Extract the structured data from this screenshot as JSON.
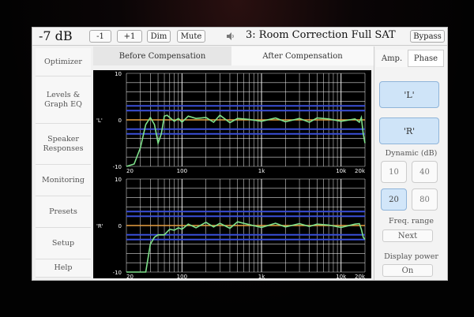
{
  "header": {
    "volume": "-7 dB",
    "btn_minus": "-1",
    "btn_plus": "+1",
    "btn_dim": "Dim",
    "btn_mute": "Mute",
    "preset_title": "3: Room Correction Full SAT",
    "btn_bypass": "Bypass"
  },
  "sidebar": {
    "items": [
      {
        "label": "Optimizer"
      },
      {
        "label": "Levels &\nGraph EQ"
      },
      {
        "label": "Speaker\nResponses"
      },
      {
        "label": "Monitoring"
      },
      {
        "label": "Presets"
      },
      {
        "label": "Setup"
      },
      {
        "label": "Help"
      }
    ]
  },
  "tabs": {
    "before": "Before Compensation",
    "after": "After Compensation"
  },
  "right_panel": {
    "tab_amp": "Amp.",
    "tab_phase": "Phase",
    "btn_left": "'L'",
    "btn_right": "'R'",
    "dynamic_label": "Dynamic (dB)",
    "dynamic_options": [
      "10",
      "40",
      "20",
      "80"
    ],
    "dynamic_selected": "20",
    "freq_label": "Freq. range",
    "freq_button": "Next",
    "power_label": "Display power",
    "power_button": "On"
  },
  "chart_data": [
    {
      "type": "line",
      "channel_label": "'L'",
      "xscale": "log",
      "xlim": [
        20,
        20000
      ],
      "ylim": [
        -10,
        10
      ],
      "x_ticks": [
        "20",
        "100",
        "1k",
        "10k",
        "20k"
      ],
      "y_ticks": [
        "10",
        "0",
        "-10"
      ],
      "grid": true,
      "reference_lines": {
        "orange": [
          0
        ],
        "blue": [
          3,
          2,
          -2,
          -3
        ]
      },
      "colors": {
        "response": "#7ee08a",
        "zero": "#e8a040",
        "band": "#3a4fd8",
        "grid": "#ffffff"
      },
      "x": [
        20,
        25,
        30,
        35,
        40,
        45,
        50,
        55,
        60,
        65,
        70,
        80,
        90,
        100,
        120,
        150,
        200,
        250,
        300,
        400,
        500,
        700,
        1000,
        1500,
        2000,
        3000,
        4000,
        5000,
        7000,
        10000,
        15000,
        17000,
        18000,
        19000,
        20000
      ],
      "y": [
        -10,
        -9.5,
        -6,
        -1,
        0.5,
        -1,
        -5,
        -3,
        0.8,
        1,
        0.5,
        -0.3,
        0.3,
        -0.5,
        0.8,
        0.3,
        0.5,
        -0.5,
        1,
        -0.6,
        0.3,
        0.1,
        -0.3,
        0.4,
        -0.4,
        0.3,
        -0.5,
        0.4,
        0.2,
        -0.3,
        0.2,
        -0.5,
        0.5,
        -3,
        -5
      ]
    },
    {
      "type": "line",
      "channel_label": "'R'",
      "xscale": "log",
      "xlim": [
        20,
        20000
      ],
      "ylim": [
        -10,
        10
      ],
      "x_ticks": [
        "20",
        "100",
        "1k",
        "10k",
        "20k"
      ],
      "y_ticks": [
        "10",
        "0",
        "-10"
      ],
      "grid": true,
      "reference_lines": {
        "orange": [
          0
        ],
        "blue": [
          3,
          2,
          -2,
          -3
        ]
      },
      "colors": {
        "response": "#7ee08a",
        "zero": "#e8a040",
        "band": "#3a4fd8",
        "grid": "#ffffff"
      },
      "x": [
        20,
        25,
        30,
        35,
        40,
        45,
        50,
        60,
        70,
        80,
        90,
        100,
        120,
        150,
        200,
        250,
        300,
        400,
        500,
        700,
        1000,
        1500,
        2000,
        3000,
        4000,
        5000,
        7000,
        10000,
        15000,
        17000,
        18000,
        19000,
        20000
      ],
      "y": [
        -10,
        -10,
        -10,
        -10,
        -4,
        -2.5,
        -2,
        -2,
        -0.8,
        -1,
        -0.5,
        -0.8,
        0.3,
        -0.5,
        0.7,
        -0.3,
        0.5,
        -0.6,
        0.8,
        0.2,
        -0.4,
        0.5,
        -0.3,
        0.4,
        -0.2,
        0.3,
        0.1,
        -0.4,
        0.3,
        0.4,
        -0.8,
        -2.5,
        -3
      ]
    }
  ]
}
